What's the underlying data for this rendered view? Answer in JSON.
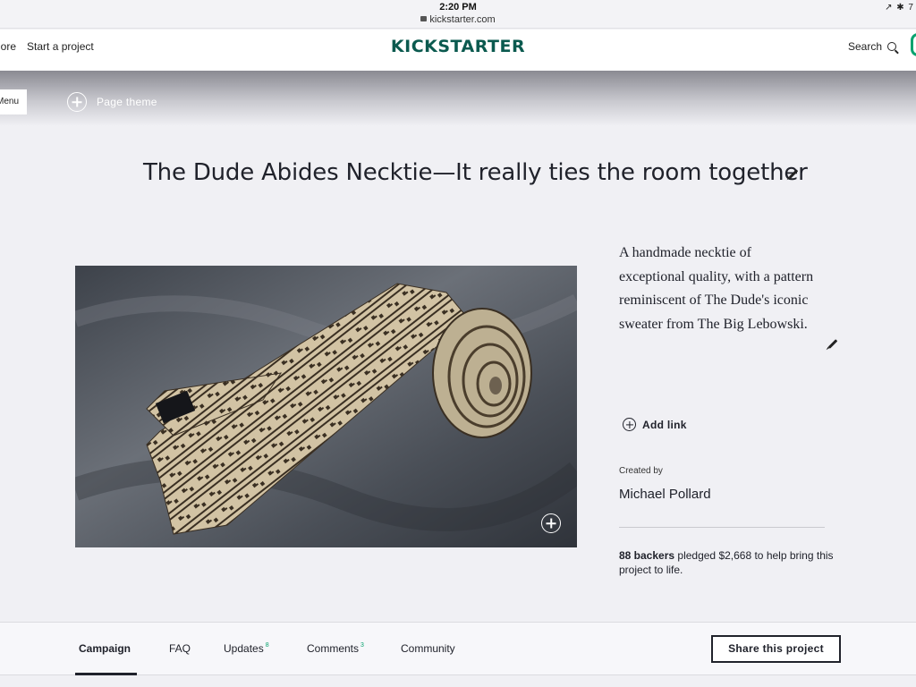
{
  "status_bar": {
    "time": "2:20 PM",
    "url": "kickstarter.com",
    "system_icons": "↗ ✱ 7"
  },
  "nav": {
    "more_label": "lore",
    "start_project_label": "Start a project",
    "logo_text": "KICKSTARTER",
    "search_label": "Search"
  },
  "theme_bar": {
    "menu_label": "Menu",
    "page_theme_label": "Page theme"
  },
  "project": {
    "title": "The Dude Abides Necktie—It really ties the room together",
    "blurb": "A handmade necktie of exceptional quality, with a pattern reminiscent of The Dude's iconic sweater from The Big Lebowski.",
    "add_link_label": "Add link",
    "created_by_label": "Created by",
    "creator_name": "Michael Pollard",
    "backers_count": "88 backers",
    "backers_text": " pledged $2,668 to help bring this project to life."
  },
  "tabs": {
    "items": [
      {
        "label": "Campaign",
        "badge": ""
      },
      {
        "label": "FAQ",
        "badge": ""
      },
      {
        "label": "Updates",
        "badge": "8"
      },
      {
        "label": "Comments",
        "badge": "3"
      },
      {
        "label": "Community",
        "badge": ""
      }
    ],
    "share_label": "Share this project"
  },
  "colors": {
    "text": "#20222b",
    "brand_green": "#0aa36f",
    "logo": "#0b5a4f",
    "background": "#f0f0f4"
  }
}
